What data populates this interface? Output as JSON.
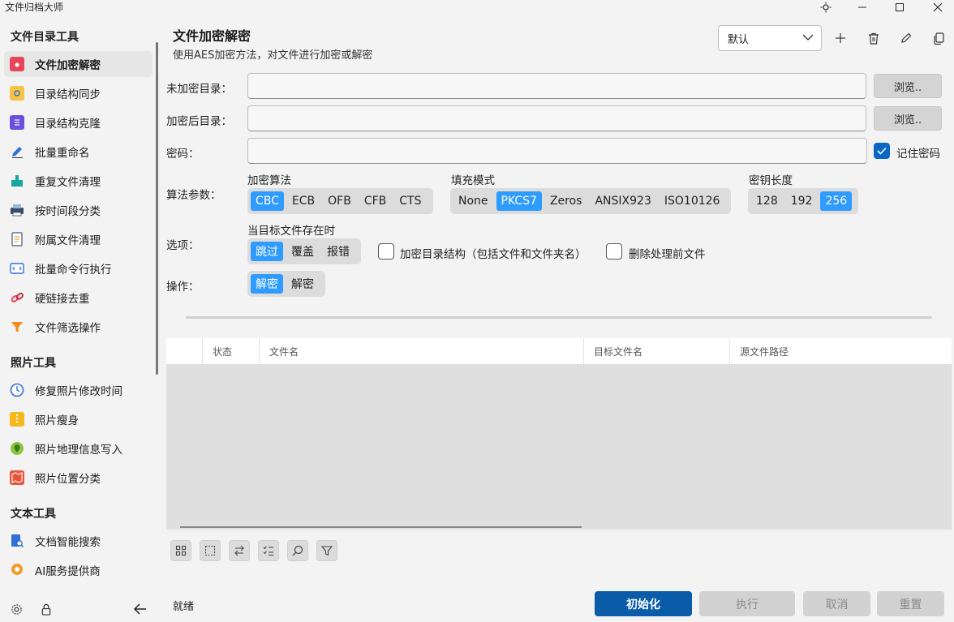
{
  "window": {
    "title": "文件归档大师"
  },
  "sidebar": {
    "sections": [
      {
        "title": "文件目录工具"
      },
      {
        "title": "照片工具"
      },
      {
        "title": "文本工具"
      }
    ],
    "items": [
      {
        "label": "文件加密解密",
        "icon": "lock-icon",
        "active": true
      },
      {
        "label": "目录结构同步",
        "icon": "sync-icon"
      },
      {
        "label": "目录结构克隆",
        "icon": "list-icon"
      },
      {
        "label": "批量重命名",
        "icon": "edit-icon"
      },
      {
        "label": "重复文件清理",
        "icon": "cleanup-icon"
      },
      {
        "label": "按时间段分类",
        "icon": "printer-icon"
      },
      {
        "label": "附属文件清理",
        "icon": "document-icon"
      },
      {
        "label": "批量命令行执行",
        "icon": "code-icon"
      },
      {
        "label": "硬链接去重",
        "icon": "link-icon"
      },
      {
        "label": "文件筛选操作",
        "icon": "filter-icon"
      },
      {
        "label": "修复照片修改时间",
        "icon": "clock-icon"
      },
      {
        "label": "照片瘦身",
        "icon": "zip-icon"
      },
      {
        "label": "照片地理信息写入",
        "icon": "map-pin-icon"
      },
      {
        "label": "照片位置分类",
        "icon": "map-icon"
      },
      {
        "label": "文档智能搜索",
        "icon": "doc-search-icon"
      },
      {
        "label": "AI服务提供商",
        "icon": "ai-icon"
      }
    ]
  },
  "page": {
    "title": "文件加密解密",
    "subtitle": "使用AES加密方法，对文件进行加密或解密"
  },
  "toolbar": {
    "preset": "默认"
  },
  "form": {
    "source_label": "未加密目录：",
    "target_label": "加密后目录：",
    "password_label": "密码：",
    "browse_label": "浏览..",
    "remember_label": "记住密码",
    "algo_params_label": "算法参数：",
    "options_label": "选项：",
    "operation_label": "操作："
  },
  "algo": {
    "cipher_label": "加密算法",
    "cipher_options": [
      "CBC",
      "ECB",
      "OFB",
      "CFB",
      "CTS"
    ],
    "cipher_selected": "CBC",
    "padding_label": "填充模式",
    "padding_options": [
      "None",
      "PKCS7",
      "Zeros",
      "ANSIX923",
      "ISO10126"
    ],
    "padding_selected": "PKCS7",
    "keylen_label": "密钥长度",
    "keylen_options": [
      "128",
      "192",
      "256"
    ],
    "keylen_selected": "256"
  },
  "options": {
    "exists_label": "当目标文件存在时",
    "exists_options": [
      "跳过",
      "覆盖",
      "报错"
    ],
    "exists_selected": "跳过",
    "encrypt_structure_label": "加密目录结构（包括文件和文件夹名）",
    "delete_source_label": "删除处理前文件"
  },
  "operation": {
    "options": [
      "解密",
      "解密"
    ],
    "selected": 0
  },
  "table": {
    "columns": [
      "",
      "状态",
      "文件名",
      "目标文件名",
      "源文件路径"
    ]
  },
  "status": "就绪",
  "actions": {
    "init": "初始化",
    "run": "执行",
    "cancel": "取消",
    "reset": "重置"
  },
  "colors": {
    "accent": "#2f9bff",
    "primary_button": "#0a5ba8",
    "checkbox": "#0a66c2"
  }
}
